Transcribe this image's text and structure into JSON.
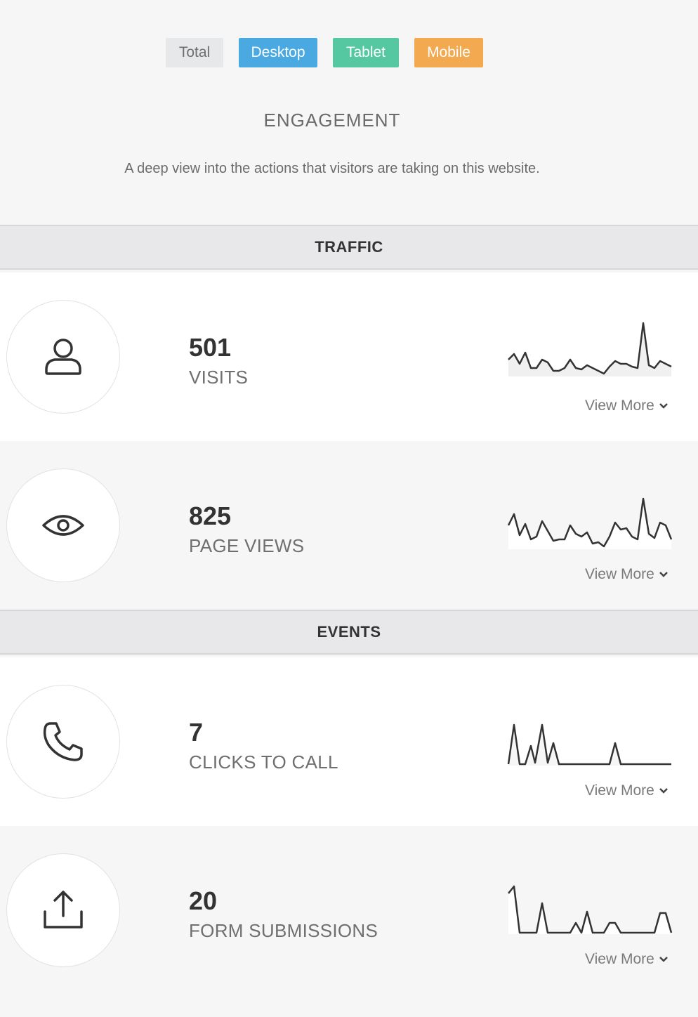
{
  "filters": {
    "total": "Total",
    "desktop": "Desktop",
    "tablet": "Tablet",
    "mobile": "Mobile"
  },
  "engagement": {
    "title": "ENGAGEMENT",
    "subtitle": "A deep view into the actions that visitors are taking on this website."
  },
  "sections": {
    "traffic": "TRAFFIC",
    "events": "EVENTS"
  },
  "metrics": [
    {
      "value": "501",
      "label": "VISITS",
      "icon": "user-icon",
      "view_more": "View More"
    },
    {
      "value": "825",
      "label": "PAGE VIEWS",
      "icon": "eye-icon",
      "view_more": "View More"
    },
    {
      "value": "7",
      "label": "CLICKS TO CALL",
      "icon": "phone-icon",
      "view_more": "View More"
    },
    {
      "value": "20",
      "label": "FORM SUBMISSIONS",
      "icon": "upload-icon",
      "view_more": "View More"
    }
  ],
  "colors": {
    "desktop": "#4aa9e0",
    "tablet": "#55c8a1",
    "mobile": "#f3a94f",
    "sparkline": "#333333"
  }
}
